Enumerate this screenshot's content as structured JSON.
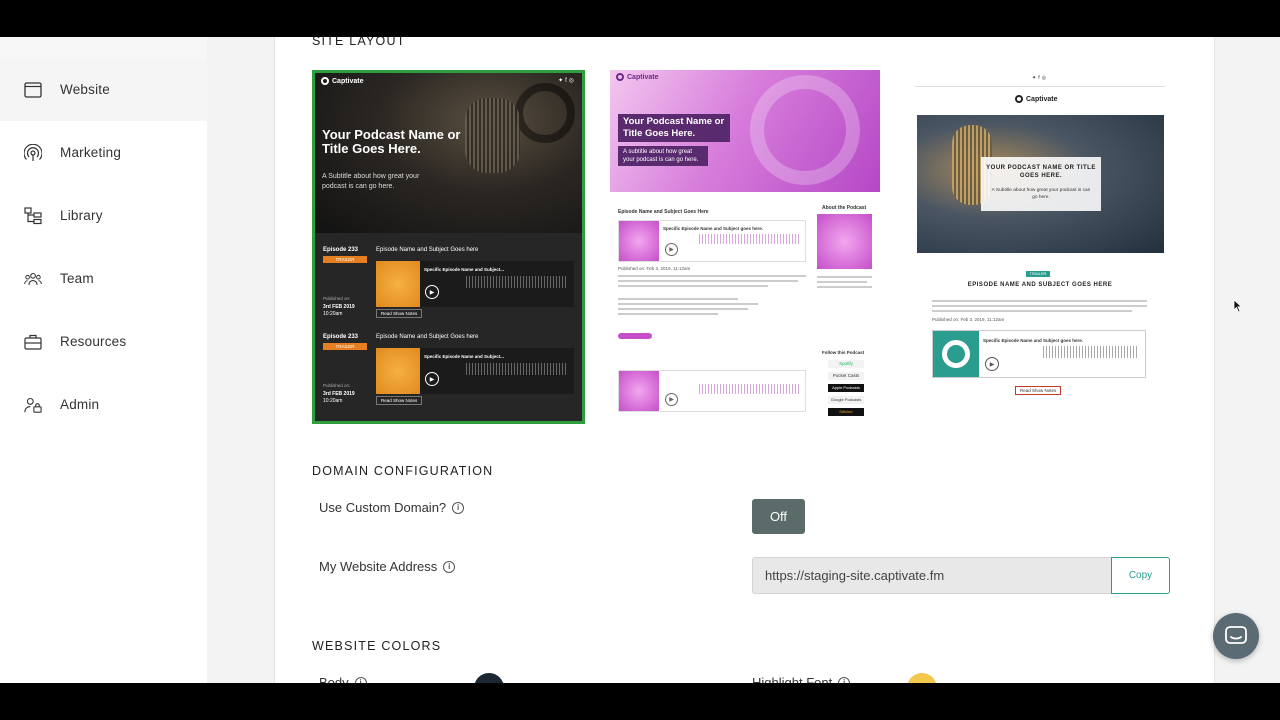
{
  "sidebar": {
    "items": [
      {
        "label": "Website",
        "icon": "browser-window-icon",
        "active": true
      },
      {
        "label": "Marketing",
        "icon": "radio-waves-icon",
        "active": false
      },
      {
        "label": "Library",
        "icon": "library-tree-icon",
        "active": false
      },
      {
        "label": "Team",
        "icon": "team-people-icon",
        "active": false
      },
      {
        "label": "Resources",
        "icon": "briefcase-icon",
        "active": false
      },
      {
        "label": "Admin",
        "icon": "admin-lock-icon",
        "active": false
      }
    ]
  },
  "site_layout": {
    "title": "SITE LAYOUT",
    "layouts": [
      {
        "selected": true,
        "brand": "Captivate",
        "hero_title": "Your Podcast Name or Title Goes Here.",
        "hero_subtitle": "A Subtitle about how great your podcast is can go here.",
        "episodes": [
          {
            "number": "Episode 233",
            "tag": "TRAILER",
            "title": "Episode Name and Subject Goes here",
            "player_title": "Specific Episode Name and Subject...",
            "published_label": "Published on:",
            "date": "3rd FEB 2019",
            "time": "10:20am",
            "notes": "Read Show Notes"
          },
          {
            "number": "Episode 233",
            "tag": "TRAILER",
            "title": "Episode Name and Subject Goes here",
            "player_title": "Specific Episode Name and Subject...",
            "published_label": "Published on:",
            "date": "3rd FEB 2019",
            "time": "10:20am",
            "notes": "Read Show Notes"
          }
        ]
      },
      {
        "selected": false,
        "brand": "Captivate",
        "hero_title": "Your Podcast Name or Title Goes Here.",
        "hero_subtitle": "A subtitle about how great your podcast is can go here.",
        "episode_title": "Episode Name and Subject Goes Here",
        "player_title": "Specific Episode Name and Subject goes here.",
        "published": "Published on: Feb 3, 2019, 11:12am",
        "about_title": "About the Podcast",
        "follow_title": "Follow this Podcast",
        "platforms": [
          "Spotify",
          "Pocket Casts",
          "Apple Podcasts",
          "Google Podcasts",
          "Stitcher"
        ]
      },
      {
        "selected": false,
        "brand": "Captivate",
        "hero_title": "YOUR PODCAST NAME OR TITLE GOES HERE.",
        "hero_subtitle": "A Subtitle about how great your podcast is can go here.",
        "tag": "TRAILER",
        "episode_title": "EPISODE NAME AND SUBJECT GOES HERE",
        "published": "Published on: Feb 3, 2019, 11:12am",
        "player_title": "Specific Episode Name and Subject goes here.",
        "notes": "Read Show Notes"
      }
    ]
  },
  "domain": {
    "title": "DOMAIN CONFIGURATION",
    "custom_label": "Use Custom Domain?",
    "toggle_value": "Off",
    "address_label": "My Website Address",
    "address_value": "https://staging-site.captivate.fm",
    "copy_label": "Copy"
  },
  "colors": {
    "title": "WEBSITE COLORS",
    "body_label": "Body",
    "highlight_label": "Highlight Font",
    "body_color": "#1c2733",
    "highlight_color": "#f2c94c",
    "accent": "#2a9d8f",
    "selected_border": "#2e9e3e"
  }
}
